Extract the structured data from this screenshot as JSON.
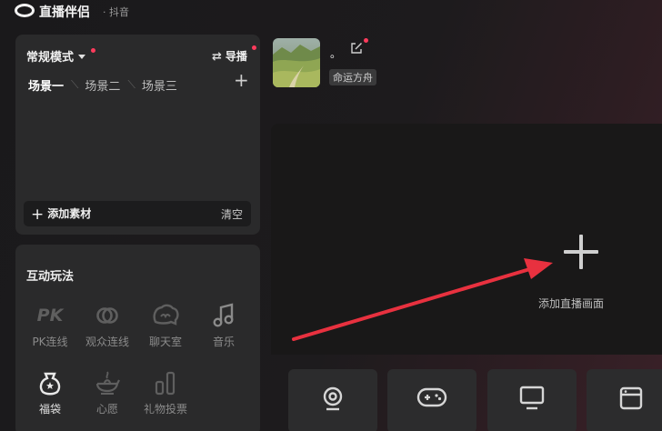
{
  "app": {
    "title": "直播伴侣",
    "platform": "· 抖音"
  },
  "scene_panel": {
    "mode_label": "常规模式",
    "director_label": "导播",
    "tabs": [
      {
        "label": "场景一",
        "active": true
      },
      {
        "label": "场景二",
        "active": false
      },
      {
        "label": "场景三",
        "active": false
      }
    ],
    "add_material_label": "添加素材",
    "clear_label": "清空"
  },
  "interact": {
    "title": "互动玩法",
    "pk_glyph": "PK",
    "features": [
      {
        "label": "PK连线",
        "icon": "pk-icon"
      },
      {
        "label": "观众连线",
        "icon": "link-icon"
      },
      {
        "label": "聊天室",
        "icon": "chat-icon"
      },
      {
        "label": "音乐",
        "icon": "music-icon"
      },
      {
        "label": "福袋",
        "icon": "lucky-bag-icon"
      },
      {
        "label": "心愿",
        "icon": "wish-lamp-icon"
      },
      {
        "label": "礼物投票",
        "icon": "vote-chart-icon"
      }
    ]
  },
  "profile": {
    "name": "。",
    "tag": "命运方舟"
  },
  "preview": {
    "add_label": "添加直播画面"
  },
  "sources": [
    "camera-icon",
    "gamepad-icon",
    "monitor-icon",
    "window-icon"
  ],
  "colors": {
    "accent_red": "#ff3b5c",
    "panel_bg": "#2a2a2b",
    "preview_bg": "#191818"
  }
}
